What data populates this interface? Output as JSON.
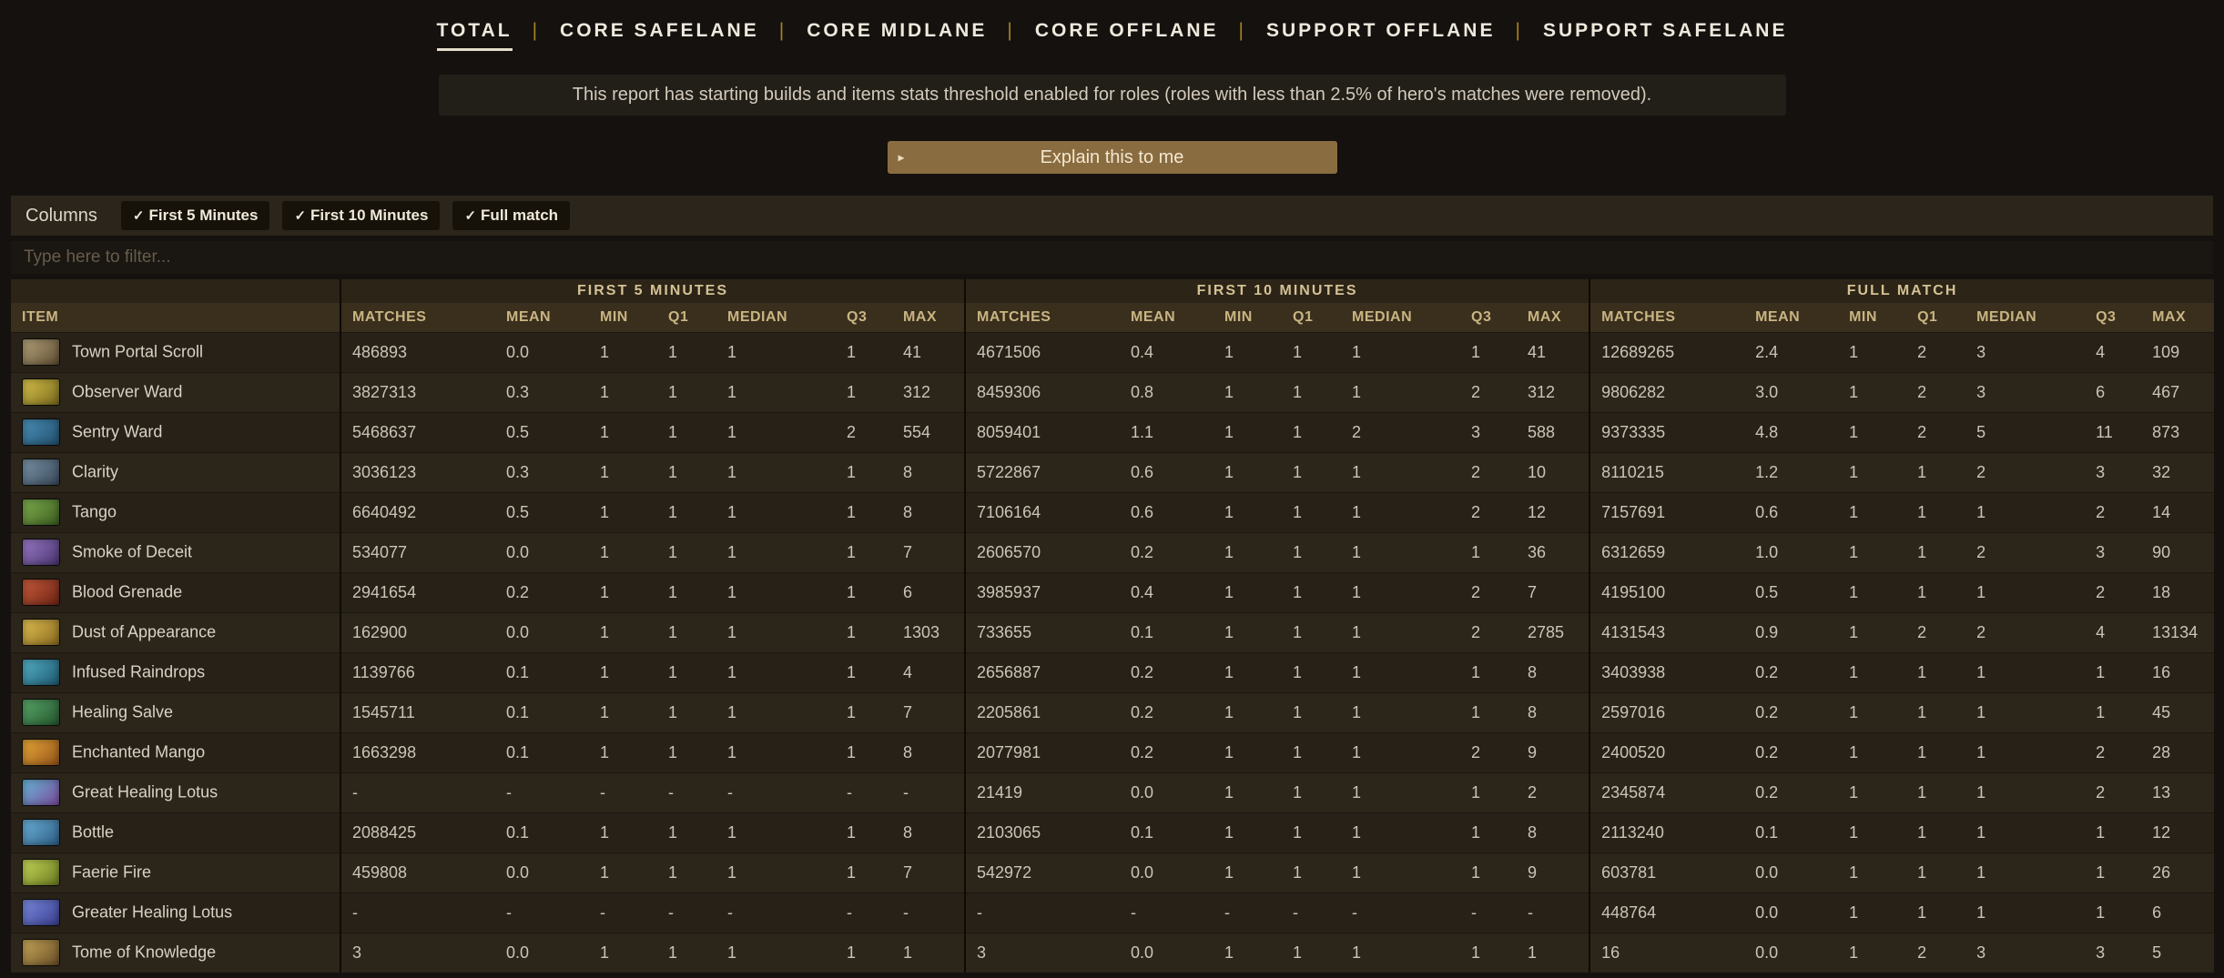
{
  "theme": {
    "accent_gold": "#a5831f",
    "button_bg": "#8a6c41",
    "header_text": "#c8b582",
    "page_bg": "#14110e"
  },
  "tabs": [
    {
      "label": "TOTAL",
      "active": true
    },
    {
      "label": "CORE SAFELANE",
      "active": false
    },
    {
      "label": "CORE MIDLANE",
      "active": false
    },
    {
      "label": "CORE OFFLANE",
      "active": false
    },
    {
      "label": "SUPPORT OFFLANE",
      "active": false
    },
    {
      "label": "SUPPORT SAFELANE",
      "active": false
    }
  ],
  "notice": {
    "text": "This report has starting builds and items stats threshold enabled for roles (roles with less than 2.5% of hero's matches were removed)."
  },
  "explain_button": {
    "label": "Explain this to me",
    "icon": "▸"
  },
  "columns_panel": {
    "label": "Columns",
    "check_glyph": "✓",
    "chips": [
      {
        "label": "First 5 Minutes",
        "checked": true
      },
      {
        "label": "First 10 Minutes",
        "checked": true
      },
      {
        "label": "Full match",
        "checked": true
      }
    ]
  },
  "filter": {
    "placeholder": "Type here to filter..."
  },
  "table": {
    "item_header": "ITEM",
    "groups": [
      "FIRST 5 MINUTES",
      "FIRST 10 MINUTES",
      "FULL MATCH"
    ],
    "stat_headers": [
      "MATCHES",
      "MEAN",
      "MIN",
      "Q1",
      "MEDIAN",
      "Q3",
      "MAX"
    ],
    "rows": [
      {
        "item": "Town Portal Scroll",
        "icon": [
          "#b5a27a",
          "#5f4f33"
        ],
        "first5": [
          "486893",
          "0.0",
          "1",
          "1",
          "1",
          "1",
          "41"
        ],
        "first10": [
          "4671506",
          "0.4",
          "1",
          "1",
          "1",
          "1",
          "41"
        ],
        "full": [
          "12689265",
          "2.4",
          "1",
          "2",
          "3",
          "4",
          "109"
        ]
      },
      {
        "item": "Observer Ward",
        "icon": [
          "#d8c24a",
          "#7a6a1e"
        ],
        "first5": [
          "3827313",
          "0.3",
          "1",
          "1",
          "1",
          "1",
          "312"
        ],
        "first10": [
          "8459306",
          "0.8",
          "1",
          "1",
          "1",
          "2",
          "312"
        ],
        "full": [
          "9806282",
          "3.0",
          "1",
          "2",
          "3",
          "6",
          "467"
        ]
      },
      {
        "item": "Sentry Ward",
        "icon": [
          "#4a90b8",
          "#23506e"
        ],
        "first5": [
          "5468637",
          "0.5",
          "1",
          "1",
          "1",
          "2",
          "554"
        ],
        "first10": [
          "8059401",
          "1.1",
          "1",
          "1",
          "2",
          "3",
          "588"
        ],
        "full": [
          "9373335",
          "4.8",
          "1",
          "2",
          "5",
          "11",
          "873"
        ]
      },
      {
        "item": "Clarity",
        "icon": [
          "#7a95a8",
          "#39495a"
        ],
        "first5": [
          "3036123",
          "0.3",
          "1",
          "1",
          "1",
          "1",
          "8"
        ],
        "first10": [
          "5722867",
          "0.6",
          "1",
          "1",
          "1",
          "2",
          "10"
        ],
        "full": [
          "8110215",
          "1.2",
          "1",
          "1",
          "2",
          "3",
          "32"
        ]
      },
      {
        "item": "Tango",
        "icon": [
          "#7fae4e",
          "#3c5e20"
        ],
        "first5": [
          "6640492",
          "0.5",
          "1",
          "1",
          "1",
          "1",
          "8"
        ],
        "first10": [
          "7106164",
          "0.6",
          "1",
          "1",
          "1",
          "2",
          "12"
        ],
        "full": [
          "7157691",
          "0.6",
          "1",
          "1",
          "1",
          "2",
          "14"
        ]
      },
      {
        "item": "Smoke of Deceit",
        "icon": [
          "#9a7ac8",
          "#4a3570"
        ],
        "first5": [
          "534077",
          "0.0",
          "1",
          "1",
          "1",
          "1",
          "7"
        ],
        "first10": [
          "2606570",
          "0.2",
          "1",
          "1",
          "1",
          "1",
          "36"
        ],
        "full": [
          "6312659",
          "1.0",
          "1",
          "1",
          "2",
          "3",
          "90"
        ]
      },
      {
        "item": "Blood Grenade",
        "icon": [
          "#c85a3a",
          "#6e2516"
        ],
        "first5": [
          "2941654",
          "0.2",
          "1",
          "1",
          "1",
          "1",
          "6"
        ],
        "first10": [
          "3985937",
          "0.4",
          "1",
          "1",
          "1",
          "2",
          "7"
        ],
        "full": [
          "4195100",
          "0.5",
          "1",
          "1",
          "1",
          "2",
          "18"
        ]
      },
      {
        "item": "Dust of Appearance",
        "icon": [
          "#e0c050",
          "#8a6a20"
        ],
        "first5": [
          "162900",
          "0.0",
          "1",
          "1",
          "1",
          "1",
          "1303"
        ],
        "first10": [
          "733655",
          "0.1",
          "1",
          "1",
          "1",
          "2",
          "2785"
        ],
        "full": [
          "4131543",
          "0.9",
          "1",
          "2",
          "2",
          "4",
          "13134"
        ]
      },
      {
        "item": "Infused Raindrops",
        "icon": [
          "#54b0c8",
          "#1f5a70"
        ],
        "first5": [
          "1139766",
          "0.1",
          "1",
          "1",
          "1",
          "1",
          "4"
        ],
        "first10": [
          "2656887",
          "0.2",
          "1",
          "1",
          "1",
          "1",
          "8"
        ],
        "full": [
          "3403938",
          "0.2",
          "1",
          "1",
          "1",
          "1",
          "16"
        ]
      },
      {
        "item": "Healing Salve",
        "icon": [
          "#58a868",
          "#25562f"
        ],
        "first5": [
          "1545711",
          "0.1",
          "1",
          "1",
          "1",
          "1",
          "7"
        ],
        "first10": [
          "2205861",
          "0.2",
          "1",
          "1",
          "1",
          "1",
          "8"
        ],
        "full": [
          "2597016",
          "0.2",
          "1",
          "1",
          "1",
          "1",
          "45"
        ]
      },
      {
        "item": "Enchanted Mango",
        "icon": [
          "#e8a838",
          "#95551a"
        ],
        "first5": [
          "1663298",
          "0.1",
          "1",
          "1",
          "1",
          "1",
          "8"
        ],
        "first10": [
          "2077981",
          "0.2",
          "1",
          "1",
          "1",
          "2",
          "9"
        ],
        "full": [
          "2400520",
          "0.2",
          "1",
          "1",
          "1",
          "2",
          "28"
        ]
      },
      {
        "item": "Great Healing Lotus",
        "icon": [
          "#68b8d8",
          "#7a4a9a"
        ],
        "first5": [
          "-",
          "-",
          "-",
          "-",
          "-",
          "-",
          "-"
        ],
        "first10": [
          "21419",
          "0.0",
          "1",
          "1",
          "1",
          "1",
          "2"
        ],
        "full": [
          "2345874",
          "0.2",
          "1",
          "1",
          "1",
          "2",
          "13"
        ]
      },
      {
        "item": "Bottle",
        "icon": [
          "#6ab0d8",
          "#2f5e85"
        ],
        "first5": [
          "2088425",
          "0.1",
          "1",
          "1",
          "1",
          "1",
          "8"
        ],
        "first10": [
          "2103065",
          "0.1",
          "1",
          "1",
          "1",
          "1",
          "8"
        ],
        "full": [
          "2113240",
          "0.1",
          "1",
          "1",
          "1",
          "1",
          "12"
        ]
      },
      {
        "item": "Faerie Fire",
        "icon": [
          "#c8d858",
          "#6a7a20"
        ],
        "first5": [
          "459808",
          "0.0",
          "1",
          "1",
          "1",
          "1",
          "7"
        ],
        "first10": [
          "542972",
          "0.0",
          "1",
          "1",
          "1",
          "1",
          "9"
        ],
        "full": [
          "603781",
          "0.0",
          "1",
          "1",
          "1",
          "1",
          "26"
        ]
      },
      {
        "item": "Greater Healing Lotus",
        "icon": [
          "#7a8ae0",
          "#3a3f90"
        ],
        "first5": [
          "-",
          "-",
          "-",
          "-",
          "-",
          "-",
          "-"
        ],
        "first10": [
          "-",
          "-",
          "-",
          "-",
          "-",
          "-",
          "-"
        ],
        "full": [
          "448764",
          "0.0",
          "1",
          "1",
          "1",
          "1",
          "6"
        ]
      },
      {
        "item": "Tome of Knowledge",
        "icon": [
          "#c8a858",
          "#6a4f28"
        ],
        "first5": [
          "3",
          "0.0",
          "1",
          "1",
          "1",
          "1",
          "1"
        ],
        "first10": [
          "3",
          "0.0",
          "1",
          "1",
          "1",
          "1",
          "1"
        ],
        "full": [
          "16",
          "0.0",
          "1",
          "2",
          "3",
          "3",
          "5"
        ]
      }
    ]
  }
}
